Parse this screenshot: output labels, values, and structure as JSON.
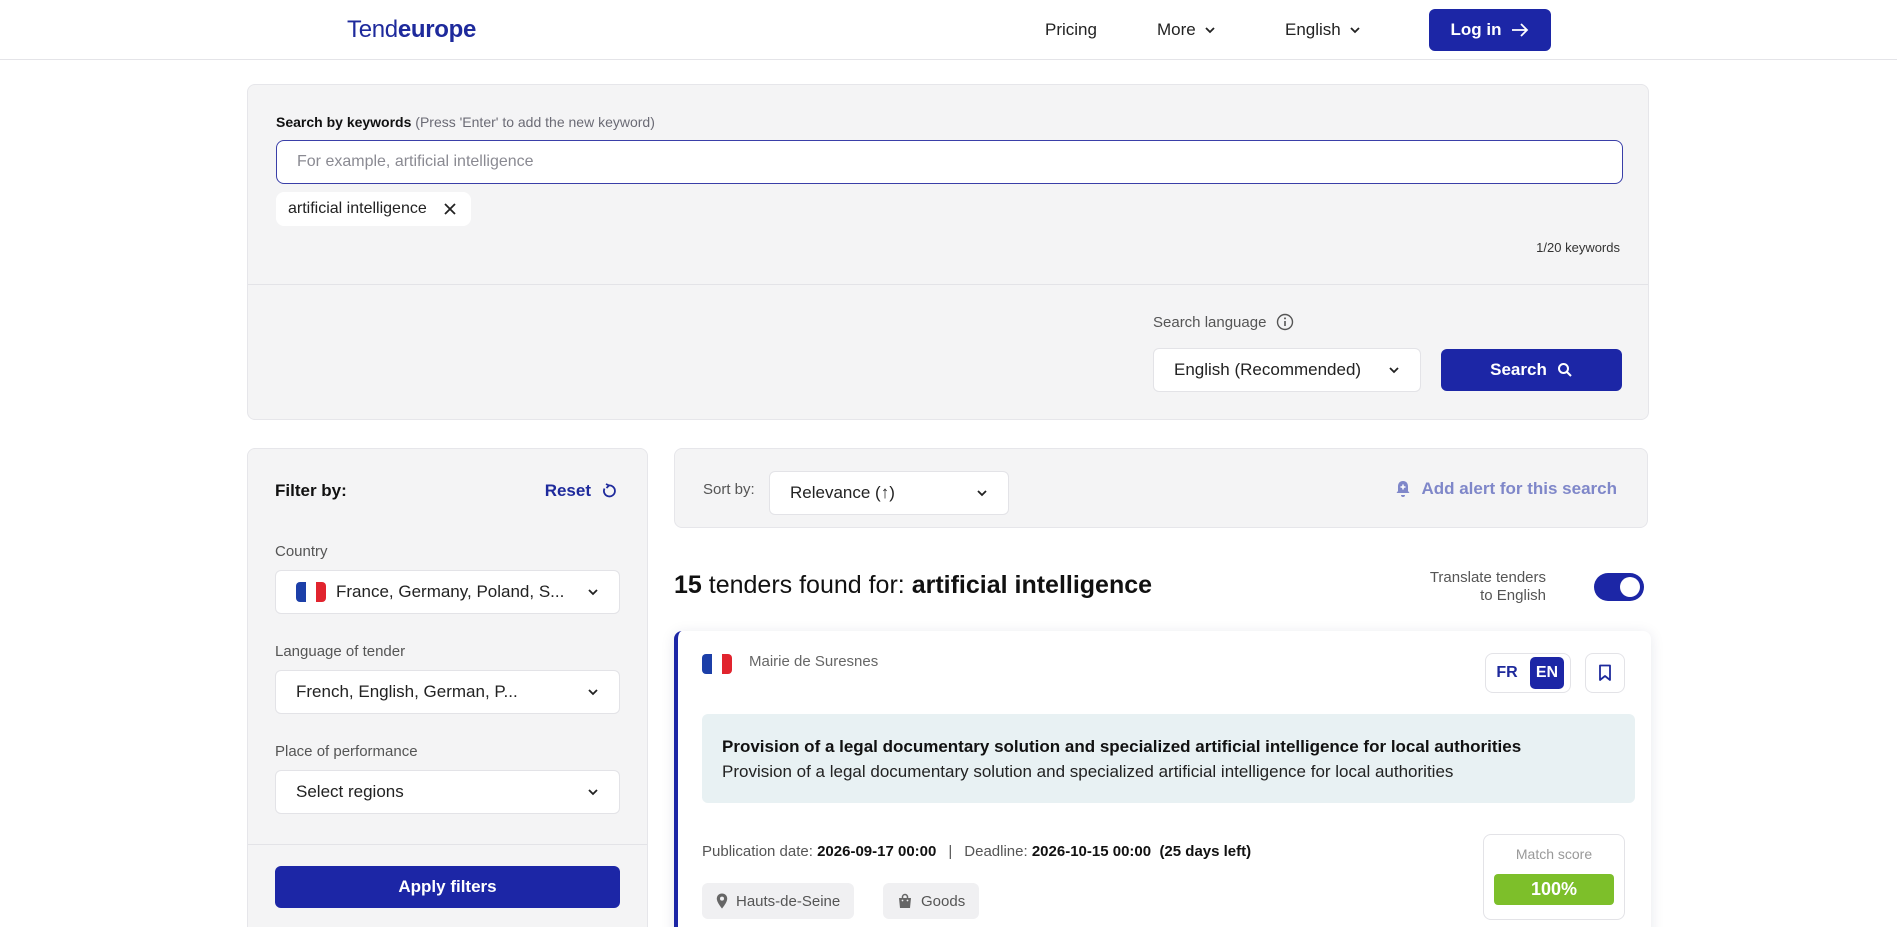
{
  "colors": {
    "accent": "#1c26a6",
    "match_green": "#7dbf2a",
    "title_bg": "#e8f1f3"
  },
  "header": {
    "logo_prefix": "Tend",
    "logo_suffix": "europe",
    "nav": {
      "pricing": "Pricing",
      "more": "More",
      "language": "English"
    },
    "login": "Log in"
  },
  "search": {
    "label_bold": "Search by keywords",
    "label_hint": "(Press 'Enter' to add the new keyword)",
    "placeholder": "For example, artificial intelligence",
    "keywords": [
      "artificial intelligence"
    ],
    "keyword_count": "1/20 keywords",
    "language_label": "Search language",
    "language_value": "English (Recommended)",
    "button": "Search"
  },
  "filters": {
    "title": "Filter by:",
    "reset": "Reset",
    "country_label": "Country",
    "country_value": "France, Germany, Poland, S...",
    "tender_language_label": "Language of tender",
    "tender_language_value": "French, English, German, P...",
    "place_label": "Place of performance",
    "place_value": "Select regions",
    "apply": "Apply filters"
  },
  "sort": {
    "label": "Sort by:",
    "value": "Relevance (↑)",
    "alert": "Add alert for this search"
  },
  "results": {
    "count": "15",
    "found_text": "tenders found for:",
    "query": "artificial intelligence",
    "translate_label": "Translate tenders to English",
    "translate_on": true
  },
  "tenders": [
    {
      "buyer": "Mairie de Suresnes",
      "lang_options": [
        "FR",
        "EN"
      ],
      "active_lang": "EN",
      "title_original": "Provision of a legal documentary solution and specialized artificial intelligence for local authorities",
      "title_translated": "Provision of a legal documentary solution and specialized artificial intelligence for local authorities",
      "publication_label": "Publication date:",
      "publication_date": "2026-09-17 00:00",
      "separator": "|",
      "deadline_label": "Deadline:",
      "deadline_date": "2026-10-15 00:00",
      "days_left": "(25 days left)",
      "location": "Hauts-de-Seine",
      "category": "Goods",
      "match_label": "Match score",
      "match_score": "100%"
    }
  ]
}
